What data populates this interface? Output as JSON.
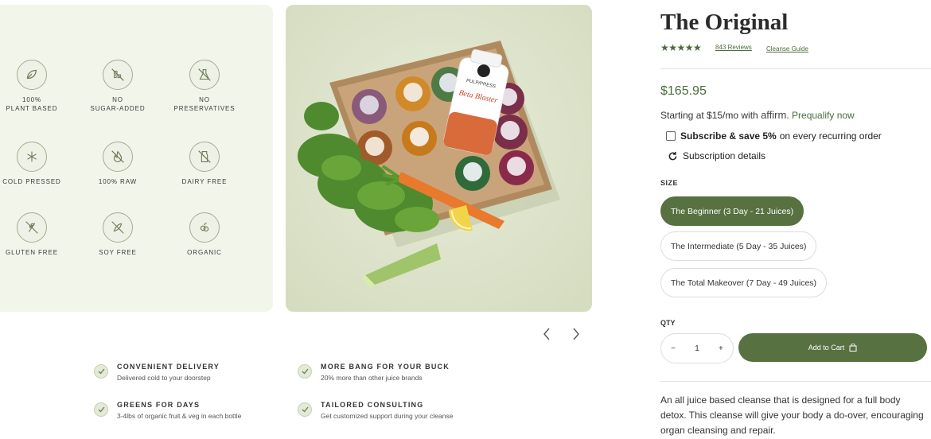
{
  "features": [
    {
      "icon": "leaf-icon",
      "label": "100%\nPLANT BASED"
    },
    {
      "icon": "no-sugar-icon",
      "label": "NO\nSUGAR-ADDED"
    },
    {
      "icon": "no-preservatives-icon",
      "label": "NO\nPRESERVATIVES"
    },
    {
      "icon": "snowflake-icon",
      "label": "COLD PRESSED"
    },
    {
      "icon": "flame-crossed-icon",
      "label": "100% RAW"
    },
    {
      "icon": "milk-crossed-icon",
      "label": "DAIRY FREE"
    },
    {
      "icon": "wheat-crossed-icon",
      "label": "GLUTEN FREE"
    },
    {
      "icon": "soy-crossed-icon",
      "label": "SOY FREE"
    },
    {
      "icon": "produce-icon",
      "label": "ORGANIC"
    }
  ],
  "gallery": {
    "bottle_brand": "PULP/PRESS",
    "bottle_flavor": "Beta Blaster",
    "prev_icon": "chevron-left-icon",
    "next_icon": "chevron-right-icon"
  },
  "benefits": [
    {
      "title": "CONVENIENT DELIVERY",
      "subtitle": "Delivered cold to your doorstep"
    },
    {
      "title": "MORE BANG FOR YOUR BUCK",
      "subtitle": "20% more than other juice brands"
    },
    {
      "title": "GREENS FOR DAYS",
      "subtitle": "3-4lbs of organic fruit & veg in each bottle"
    },
    {
      "title": "TAILORED CONSULTING",
      "subtitle": "Get customized support during your cleanse"
    }
  ],
  "product": {
    "title": "The Original",
    "stars": "★★★★★",
    "rating": 5,
    "reviews_label": "843 Reviews",
    "guide_label": "Cleanse Guide",
    "price": "$165.95",
    "affirm_prefix": "Starting at $15/mo with",
    "affirm_brand": "affirm",
    "affirm_link": "Prequalify now",
    "subscribe_bold": "Subscribe & save 5%",
    "subscribe_rest": "on every recurring order",
    "subscription_details": "Subscription details",
    "size_label": "SIZE",
    "sizes": [
      {
        "label": "The Beginner (3 Day - 21 Juices)",
        "selected": true
      },
      {
        "label": "The Intermediate (5 Day - 35 Juices)",
        "selected": false
      },
      {
        "label": "The Total Makeover (7 Day - 49 Juices)",
        "selected": false
      }
    ],
    "qty_label": "QTY",
    "qty_minus": "−",
    "qty_value": "1",
    "qty_plus": "+",
    "add_to_cart": "Add to Cart",
    "description": "An all juice based cleanse that is designed for a full body detox. This cleanse will give your body a do-over, encouraging organ cleansing and repair."
  },
  "colors": {
    "accent": "#577140",
    "link": "#4a6b3c",
    "panel_bg": "#f1f5ea"
  }
}
